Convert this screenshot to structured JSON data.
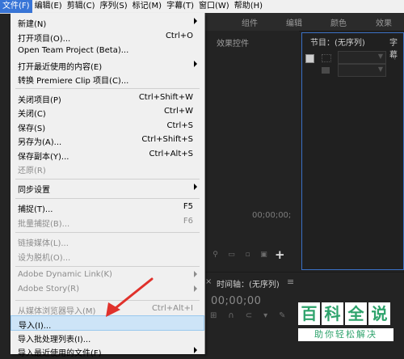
{
  "menubar": {
    "items": [
      "文件(F)",
      "编辑(E)",
      "剪辑(C)",
      "序列(S)",
      "标记(M)",
      "字幕(T)",
      "窗口(W)",
      "帮助(H)"
    ]
  },
  "tabs": [
    "组件",
    "编辑",
    "颜色",
    "效果"
  ],
  "effects_panel": {
    "title": "效果控件",
    "timecode": "00;00;00;"
  },
  "program_panel": {
    "title": "节目：(无序列)",
    "tab2": "字幕"
  },
  "timeline": {
    "close": "×",
    "title": "时间轴：(无序列)",
    "menu": "≡",
    "timecode": "00;00;00"
  },
  "watermark": {
    "chars": [
      "百",
      "科",
      "全",
      "说"
    ],
    "sub": "助你轻松解决"
  },
  "file_menu": {
    "items": [
      {
        "label": "新建(N)",
        "shortcut": "",
        "submenu": true,
        "disabled": false
      },
      {
        "label": "打开项目(O)...",
        "shortcut": "Ctrl+O",
        "submenu": false,
        "disabled": false
      },
      {
        "label": "Open Team Project (Beta)...",
        "shortcut": "",
        "submenu": false,
        "disabled": false
      },
      {
        "label": "打开最近使用的内容(E)",
        "shortcut": "",
        "submenu": true,
        "disabled": false
      },
      {
        "label": "转换 Premiere Clip 项目(C)...",
        "shortcut": "",
        "submenu": false,
        "disabled": false
      },
      {
        "label": "关闭项目(P)",
        "shortcut": "Ctrl+Shift+W",
        "submenu": false,
        "disabled": false
      },
      {
        "label": "关闭(C)",
        "shortcut": "Ctrl+W",
        "submenu": false,
        "disabled": false
      },
      {
        "label": "保存(S)",
        "shortcut": "Ctrl+S",
        "submenu": false,
        "disabled": false
      },
      {
        "label": "另存为(A)...",
        "shortcut": "Ctrl+Shift+S",
        "submenu": false,
        "disabled": false
      },
      {
        "label": "保存副本(Y)...",
        "shortcut": "Ctrl+Alt+S",
        "submenu": false,
        "disabled": false
      },
      {
        "label": "还原(R)",
        "shortcut": "",
        "submenu": false,
        "disabled": true
      },
      {
        "label": "同步设置",
        "shortcut": "",
        "submenu": true,
        "disabled": false
      },
      {
        "label": "捕捉(T)...",
        "shortcut": "F5",
        "submenu": false,
        "disabled": false
      },
      {
        "label": "批量捕捉(B)...",
        "shortcut": "F6",
        "submenu": false,
        "disabled": true
      },
      {
        "label": "链接媒体(L)...",
        "shortcut": "",
        "submenu": false,
        "disabled": true
      },
      {
        "label": "设为脱机(O)...",
        "shortcut": "",
        "submenu": false,
        "disabled": true
      },
      {
        "label": "Adobe Dynamic Link(K)",
        "shortcut": "",
        "submenu": true,
        "disabled": true
      },
      {
        "label": "Adobe Story(R)",
        "shortcut": "",
        "submenu": true,
        "disabled": true
      },
      {
        "label": "从媒体浏览器导入(M)",
        "shortcut": "Ctrl+Alt+I",
        "submenu": false,
        "disabled": true
      },
      {
        "label": "导入(I)...",
        "shortcut": "",
        "submenu": false,
        "disabled": false,
        "highlighted": true
      },
      {
        "label": "导入批处理列表(I)...",
        "shortcut": "",
        "submenu": false,
        "disabled": false
      },
      {
        "label": "导入最近使用的文件(F)",
        "shortcut": "",
        "submenu": true,
        "disabled": false
      }
    ]
  },
  "colors": {
    "highlight": "#cde4f7",
    "menubar_active": "#3875d7",
    "arrow": "#e0312b",
    "panel_border": "#3a70c5",
    "watermark_green": "#2ea36c"
  }
}
